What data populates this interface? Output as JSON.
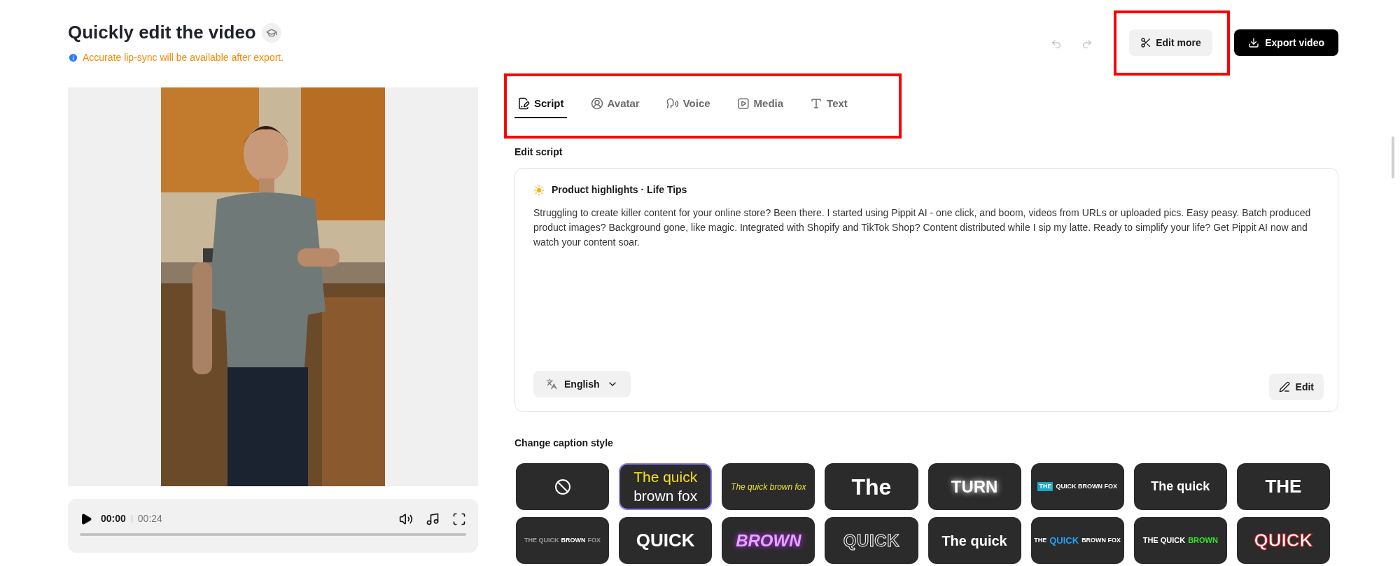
{
  "header": {
    "title": "Quickly edit the video",
    "notice": "Accurate lip-sync will be available after export."
  },
  "actions": {
    "undo": {
      "disabled": true
    },
    "redo": {
      "disabled": true
    },
    "edit_more": {
      "label": "Edit more",
      "highlighted": true
    },
    "export": {
      "label": "Export video"
    }
  },
  "tabs_highlighted": true,
  "tabs": [
    {
      "label": "Script",
      "kind": "script",
      "selected": true
    },
    {
      "label": "Avatar",
      "kind": "avatar",
      "selected": false
    },
    {
      "label": "Voice",
      "kind": "voice",
      "selected": false
    },
    {
      "label": "Media",
      "kind": "media",
      "selected": false
    },
    {
      "label": "Text",
      "kind": "text",
      "selected": false
    }
  ],
  "player": {
    "current": "00:00",
    "duration": "00:24",
    "level": 0
  },
  "script": {
    "section_title": "Edit script",
    "topic": "Product highlights · Life Tips",
    "body": "Struggling to create killer content for your online store? Been there. I started using Pippit AI - one click, and boom, videos from URLs or uploaded pics. Easy peasy. Batch produced product images? Background gone, like magic. Integrated with Shopify and TikTok Shop? Content distributed while I sip my latte. Ready to simplify your life? Get Pippit AI now and watch your content soar.",
    "language": "English",
    "edit": "Edit"
  },
  "caption_styles": {
    "title": "Change caption style",
    "tiles": [
      {
        "kind": "none",
        "selected": false
      },
      {
        "kind": "two-line",
        "selected": true,
        "parts": [
          {
            "text": "The quick",
            "accent": true
          },
          {
            "text": "brown fox",
            "accent": false
          }
        ]
      },
      {
        "kind": "script",
        "selected": false,
        "parts": [
          {
            "text": "The quick brown fox",
            "accent": true
          }
        ]
      },
      {
        "kind": "big",
        "selected": false,
        "parts": [
          {
            "text": "The"
          }
        ]
      },
      {
        "kind": "glow",
        "selected": false,
        "parts": [
          {
            "text": "TURN"
          }
        ]
      },
      {
        "kind": "boxed",
        "selected": false,
        "parts": [
          {
            "text": "THE",
            "accent": true
          },
          {
            "text": "QUICK BROWN FOX",
            "accent": false
          }
        ]
      },
      {
        "kind": "bold",
        "selected": false,
        "parts": [
          {
            "text": "The quick"
          }
        ]
      },
      {
        "kind": "heavy",
        "selected": false,
        "parts": [
          {
            "text": "THE"
          }
        ]
      },
      {
        "kind": "mixed",
        "selected": false,
        "parts": [
          {
            "text": "THE QUICK",
            "accent": false
          },
          {
            "text": "BROWN",
            "accent": true
          },
          {
            "text": "FOX",
            "accent": false
          }
        ]
      },
      {
        "kind": "heavy",
        "selected": false,
        "parts": [
          {
            "text": "QUICK"
          }
        ]
      },
      {
        "kind": "purple",
        "selected": false,
        "parts": [
          {
            "text": "BROWN",
            "accent": false
          }
        ]
      },
      {
        "kind": "outline",
        "selected": false,
        "parts": [
          {
            "text": "QUICK",
            "accent": false
          }
        ]
      },
      {
        "kind": "condensed",
        "selected": false,
        "parts": [
          {
            "text": "The quick"
          }
        ]
      },
      {
        "kind": "blue-word",
        "selected": false,
        "parts": [
          {
            "text": "THE",
            "accent": false
          },
          {
            "text": "QUICK",
            "accent": true
          },
          {
            "text": "BROWN FOX",
            "accent": false
          }
        ]
      },
      {
        "kind": "green-word",
        "selected": false,
        "parts": [
          {
            "text": "THE QUICK",
            "accent": false
          },
          {
            "text": "BROWN",
            "accent": true
          }
        ]
      },
      {
        "kind": "red",
        "selected": false,
        "parts": [
          {
            "text": "QUICK"
          }
        ]
      }
    ]
  }
}
